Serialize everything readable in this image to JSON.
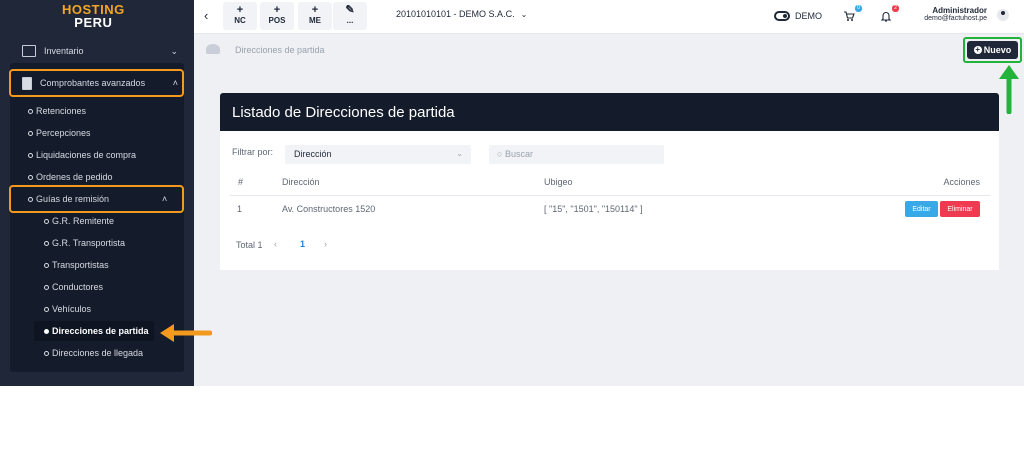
{
  "logo": {
    "line1": "HOSTING",
    "line2": "PERU"
  },
  "sidebar": {
    "inventario": "Inventario",
    "comprobantes": "Comprobantes avanzados",
    "items": [
      "Retenciones",
      "Percepciones",
      "Liquidaciones de compra",
      "Ordenes de pedido"
    ],
    "guias": "Guías de remisión",
    "guias_items": [
      "G.R. Remitente",
      "G.R. Transportista",
      "Transportistas",
      "Conductores",
      "Vehículos",
      "Direcciones de partida",
      "Direcciones de llegada"
    ]
  },
  "topbar": {
    "back": "‹",
    "buttons": [
      {
        "icon": "+",
        "label": "NC"
      },
      {
        "icon": "+",
        "label": "POS"
      },
      {
        "icon": "+",
        "label": "ME"
      },
      {
        "icon": "✎",
        "label": "..."
      }
    ],
    "company": "20101010101 - DEMO S.A.C.",
    "demo": "DEMO",
    "cart_badge": "0",
    "bell_badge": "2",
    "user_name": "Administrador",
    "user_email": "demo@factuhost.pe"
  },
  "breadcrumb": "Direcciones de partida",
  "nuevo_label": "Nuevo",
  "card": {
    "title": "Listado de Direcciones de partida",
    "filter_label": "Filtrar por:",
    "filter_value": "Dirección",
    "search_placeholder": "Buscar",
    "headers": [
      "#",
      "Dirección",
      "Ubigeo",
      "Acciones"
    ],
    "row": {
      "num": "1",
      "direccion": "Av. Constructores 1520",
      "ubigeo": "[ \"15\", \"1501\", \"150114\" ]"
    },
    "edit_label": "Editar",
    "delete_label": "Eliminar",
    "total": "Total 1",
    "page": "1",
    "prev": "‹",
    "next": "›"
  },
  "colors": {
    "sidebar": "#1f2738",
    "highlight_orange": "#f39a1e",
    "highlight_green": "#22b33a",
    "edit": "#38a8e6",
    "delete": "#ef3b4f"
  }
}
